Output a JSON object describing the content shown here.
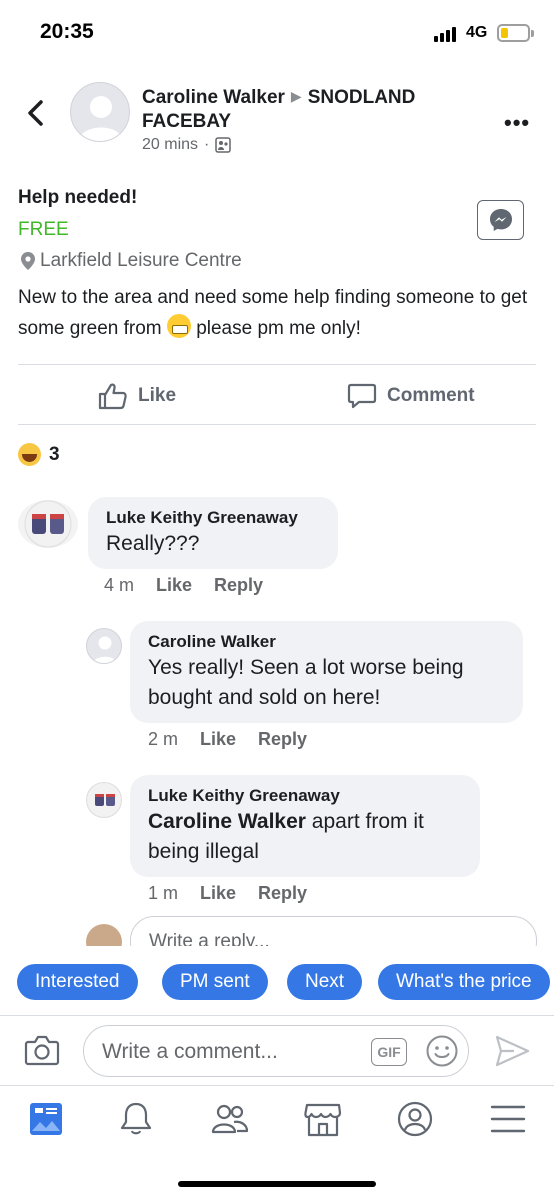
{
  "status_bar": {
    "time": "20:35",
    "network": "4G",
    "battery_color": "#f5c400"
  },
  "post": {
    "author": "Caroline Walker",
    "group": "SNODLAND FACEBAY",
    "time": "20 mins",
    "title": "Help needed!",
    "price": "FREE",
    "location": "Larkfield Leisure Centre",
    "text_before_emoji": "New to the area and need some help finding someone to get some green from",
    "text_after_emoji": "please pm me only!",
    "reaction_count": "3"
  },
  "actions": {
    "like": "Like",
    "comment": "Comment"
  },
  "comments": [
    {
      "author": "Luke Keithy Greenaway",
      "text": "Really???",
      "time": "4 m",
      "like": "Like",
      "reply": "Reply"
    },
    {
      "author": "Caroline Walker",
      "text": "Yes really! Seen a lot worse being bought and sold on here!",
      "time": "2 m",
      "like": "Like",
      "reply": "Reply"
    },
    {
      "author": "Luke Keithy Greenaway",
      "tag": "Caroline Walker",
      "text": "apart from it being illegal",
      "time": "1 m",
      "like": "Like",
      "reply": "Reply"
    }
  ],
  "reply_placeholder": "Write a reply...",
  "quick_replies": [
    "Interested",
    "PM sent",
    "Next",
    "What's the price"
  ],
  "composer": {
    "placeholder": "Write a comment...",
    "gif": "GIF"
  },
  "colors": {
    "accent": "#3578e5",
    "price": "#42b72a",
    "bubble": "#f0f2f5"
  }
}
